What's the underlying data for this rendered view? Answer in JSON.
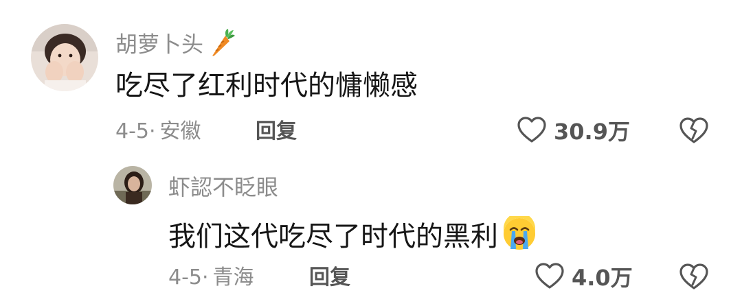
{
  "comments": [
    {
      "username": "胡萝卜头",
      "username_emoji": "carrot-icon",
      "text": "吃尽了红利时代的慵懒感",
      "date": "4-5",
      "location": "安徽",
      "reply_label": "回复",
      "likes": "30.9万"
    },
    {
      "username": "虾認不眨眼",
      "text": "我们这代吃尽了时代的黑利",
      "text_emoji": "crying-face-icon",
      "date": "4-5",
      "location": "青海",
      "reply_label": "回复",
      "likes": "4.0万"
    }
  ],
  "separator": "·",
  "colors": {
    "meta_gray": "#8c8c8c",
    "body_text": "#161616",
    "action_gray": "#555555"
  }
}
